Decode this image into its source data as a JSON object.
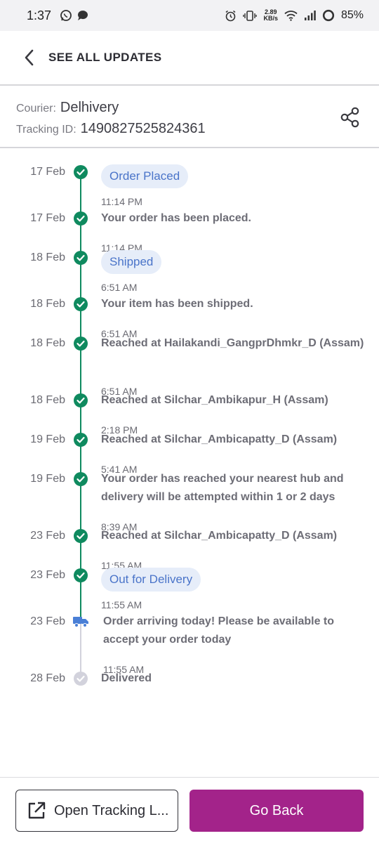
{
  "status_bar": {
    "time": "1:37",
    "speed_value": "2.89",
    "speed_unit": "KB/s",
    "battery": "85%"
  },
  "header": {
    "title": "SEE ALL UPDATES"
  },
  "courier": {
    "courier_label": "Courier:",
    "courier_name": "Delhivery",
    "tracking_label": "Tracking ID:",
    "tracking_id": "1490827525824361"
  },
  "colors": {
    "accent_green": "#0f8a5f",
    "accent_purple": "#a3238a",
    "chip_bg": "#e6edf9",
    "chip_text": "#4a74c9",
    "pending_gray": "#d2d2dc"
  },
  "timeline": {
    "events": [
      {
        "date": "17 Feb",
        "type": "chip",
        "text": "Order Placed",
        "time": "11:14 PM",
        "status": "done"
      },
      {
        "date": "17 Feb",
        "type": "text",
        "text": "Your order has been placed.",
        "time": "11:14 PM",
        "status": "done"
      },
      {
        "date": "18 Feb",
        "type": "chip",
        "text": "Shipped",
        "time": "6:51 AM",
        "status": "done"
      },
      {
        "date": "18 Feb",
        "type": "text",
        "text": "Your item has been shipped.",
        "time": "6:51 AM",
        "status": "done"
      },
      {
        "date": "18 Feb",
        "type": "text",
        "text": "Reached at Hailakandi_GangprDhmkr_D (Assam)",
        "time": "6:51 AM",
        "status": "done"
      },
      {
        "date": "18 Feb",
        "type": "text",
        "text": "Reached at Silchar_Ambikapur_H (Assam)",
        "time": "2:18 PM",
        "status": "done"
      },
      {
        "date": "19 Feb",
        "type": "text",
        "text": "Reached at Silchar_Ambicapatty_D (Assam)",
        "time": "5:41 AM",
        "status": "done"
      },
      {
        "date": "19 Feb",
        "type": "text",
        "text": "Your order has reached your nearest hub and delivery will be attempted within 1 or 2 days",
        "time": "8:39 AM",
        "status": "done"
      },
      {
        "date": "23 Feb",
        "type": "text",
        "text": "Reached at Silchar_Ambicapatty_D (Assam)",
        "time": "11:55 AM",
        "status": "done"
      },
      {
        "date": "23 Feb",
        "type": "chip",
        "text": "Out for Delivery",
        "time": "11:55 AM",
        "status": "done"
      },
      {
        "date": "23 Feb",
        "type": "text",
        "text": "Order arriving today! Please be available to accept your order today",
        "time": "11:55 AM",
        "status": "current",
        "icon": "truck-icon"
      },
      {
        "date": "28 Feb",
        "type": "text",
        "text": "Delivered",
        "time": "",
        "status": "pending"
      }
    ]
  },
  "footer": {
    "open_tracking_label": "Open Tracking L...",
    "go_back_label": "Go Back"
  }
}
